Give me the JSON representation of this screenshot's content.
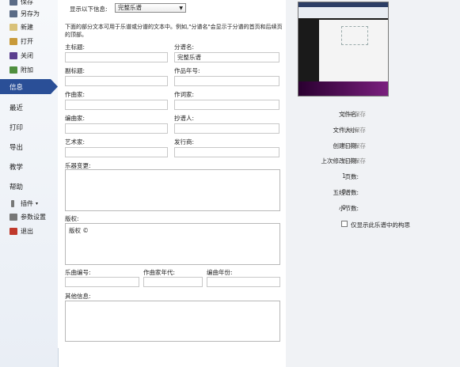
{
  "sidebar": {
    "items": [
      {
        "label": "保存",
        "icon": "save-icon",
        "color": "#5a6b86"
      },
      {
        "label": "另存为",
        "icon": "save-as-icon",
        "color": "#5a6b86"
      },
      {
        "label": "新建",
        "icon": "new-document-icon",
        "color": "#d9c27a"
      },
      {
        "label": "打开",
        "icon": "open-folder-icon",
        "color": "#c89a3a"
      },
      {
        "label": "关闭",
        "icon": "close-folder-icon",
        "color": "#5b3f8f"
      },
      {
        "label": "附加",
        "icon": "attach-icon",
        "color": "#4f8f3f"
      }
    ],
    "active": "信息",
    "nav": [
      "最近",
      "打印",
      "导出",
      "教学",
      "帮助"
    ],
    "bottom": [
      {
        "label": "插件",
        "icon": "plugin-icon",
        "color": "#777777"
      },
      {
        "label": "参数设置",
        "icon": "settings-icon",
        "color": "#777777"
      },
      {
        "label": "退出",
        "icon": "exit-icon",
        "color": "#c0392b"
      }
    ]
  },
  "header": {
    "show_label": "显示以下信息:",
    "select_value": "完整乐谱"
  },
  "description": "下面的部分文本可用于乐谱或分谱的文本中。例如,\"分谱名\"会显示于分谱的首页和后续页的顶部。",
  "fields": {
    "title": {
      "label": "主标题:",
      "value": ""
    },
    "part_name": {
      "label": "分谱名:",
      "value": "完整乐谱"
    },
    "subtitle": {
      "label": "副标题:",
      "value": ""
    },
    "year": {
      "label": "作品年号:",
      "value": ""
    },
    "composer": {
      "label": "作曲家:",
      "value": ""
    },
    "lyricist": {
      "label": "作词家:",
      "value": ""
    },
    "arranger": {
      "label": "编曲家:",
      "value": ""
    },
    "copyist": {
      "label": "抄谱人:",
      "value": ""
    },
    "artist": {
      "label": "艺术家:",
      "value": ""
    },
    "publisher": {
      "label": "发行商:",
      "value": ""
    },
    "instrument_changes": {
      "label": "乐器变更:",
      "value": ""
    },
    "copyright": {
      "label": "版权:",
      "value": "版权 ©"
    },
    "opus": {
      "label": "乐曲编号:",
      "value": ""
    },
    "composer_dates": {
      "label": "作曲家年代:",
      "value": ""
    },
    "composition_year": {
      "label": "编曲年份:",
      "value": ""
    },
    "other": {
      "label": "其他信息:",
      "value": ""
    }
  },
  "properties": [
    {
      "label": "文件名:",
      "value": "尚未保存"
    },
    {
      "label": "文件大小:",
      "value": "尚未保存"
    },
    {
      "label": "创建日期:",
      "value": "尚未保存"
    },
    {
      "label": "上次修改日期:",
      "value": "尚未保存"
    },
    {
      "label": "页数:",
      "value": "1"
    },
    {
      "label": "五线谱数:",
      "value": "0"
    },
    {
      "label": "小节数:",
      "value": "0"
    }
  ],
  "checkbox": {
    "label": "仅显示此乐谱中的构思",
    "checked": false
  }
}
